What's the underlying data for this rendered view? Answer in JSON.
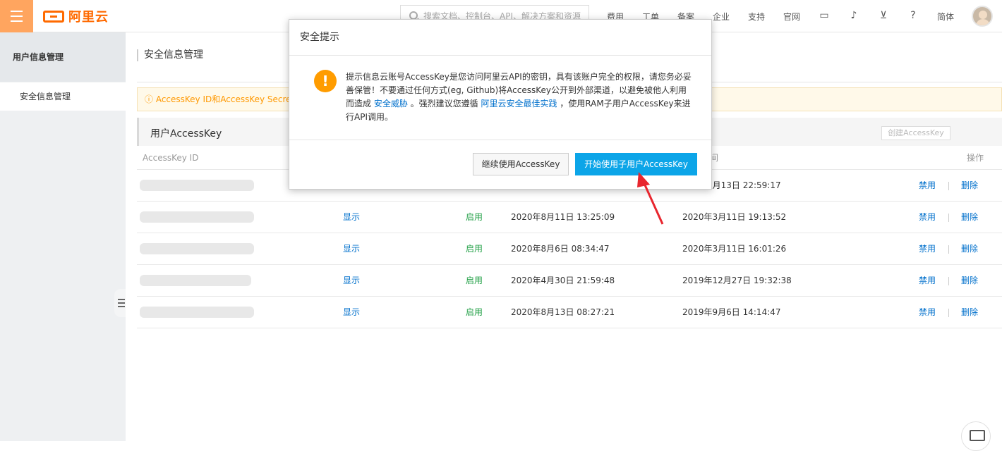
{
  "topbar": {
    "logo_text": "阿里云",
    "search_placeholder": "搜索文档、控制台、API、解决方案和资源",
    "nav": [
      "费用",
      "工单",
      "备案",
      "企业",
      "支持",
      "官网"
    ],
    "lang": "简体"
  },
  "sidebar": {
    "heading": "用户信息管理",
    "items": [
      {
        "label": "安全信息管理"
      }
    ]
  },
  "main": {
    "page_title": "安全信息管理",
    "alert_text": "ⓘ AccessKey ID和AccessKey Secret是",
    "panel_title": "用户AccessKey",
    "create_label": "创建AccessKey",
    "table": {
      "headers": [
        "AccessKey ID",
        "间",
        "操作"
      ],
      "rows": [
        {
          "show": "",
          "status": "",
          "last_used": "",
          "created": "3月13日 22:59:17",
          "disable": "禁用",
          "delete": "删除"
        },
        {
          "show": "显示",
          "status": "启用",
          "last_used": "2020年8月11日 13:25:09",
          "created": "2020年3月11日 19:13:52",
          "disable": "禁用",
          "delete": "删除"
        },
        {
          "show": "显示",
          "status": "启用",
          "last_used": "2020年8月6日 08:34:47",
          "created": "2020年3月11日 16:01:26",
          "disable": "禁用",
          "delete": "删除"
        },
        {
          "show": "显示",
          "status": "启用",
          "last_used": "2020年4月30日 21:59:48",
          "created": "2019年12月27日 19:32:38",
          "disable": "禁用",
          "delete": "删除"
        },
        {
          "show": "显示",
          "status": "启用",
          "last_used": "2020年8月13日 08:27:21",
          "created": "2019年9月6日 14:14:47",
          "disable": "禁用",
          "delete": "删除"
        }
      ]
    }
  },
  "dialog": {
    "title": "安全提示",
    "body_1": "提示信息云账号AccessKey是您访问阿里云API的密钥，具有该账户完全的权限，请您务必妥善保管！不要通过任何方式(eg, Github)将AccessKey公开到外部渠道，以避免被他人利用而造成 ",
    "link_1": "安全威胁",
    "body_2": " 。强烈建议您遵循 ",
    "link_2": "阿里云安全最佳实践",
    "body_3": " ，使用RAM子用户AccessKey来进行API调用。",
    "secondary_label": "继续使用AccessKey",
    "primary_label": "开始使用子用户AccessKey"
  },
  "colors": {
    "accent": "#0ca5e8",
    "brand": "#ff6a00",
    "warning": "#ff9c00",
    "arrow": "#e8262e"
  }
}
